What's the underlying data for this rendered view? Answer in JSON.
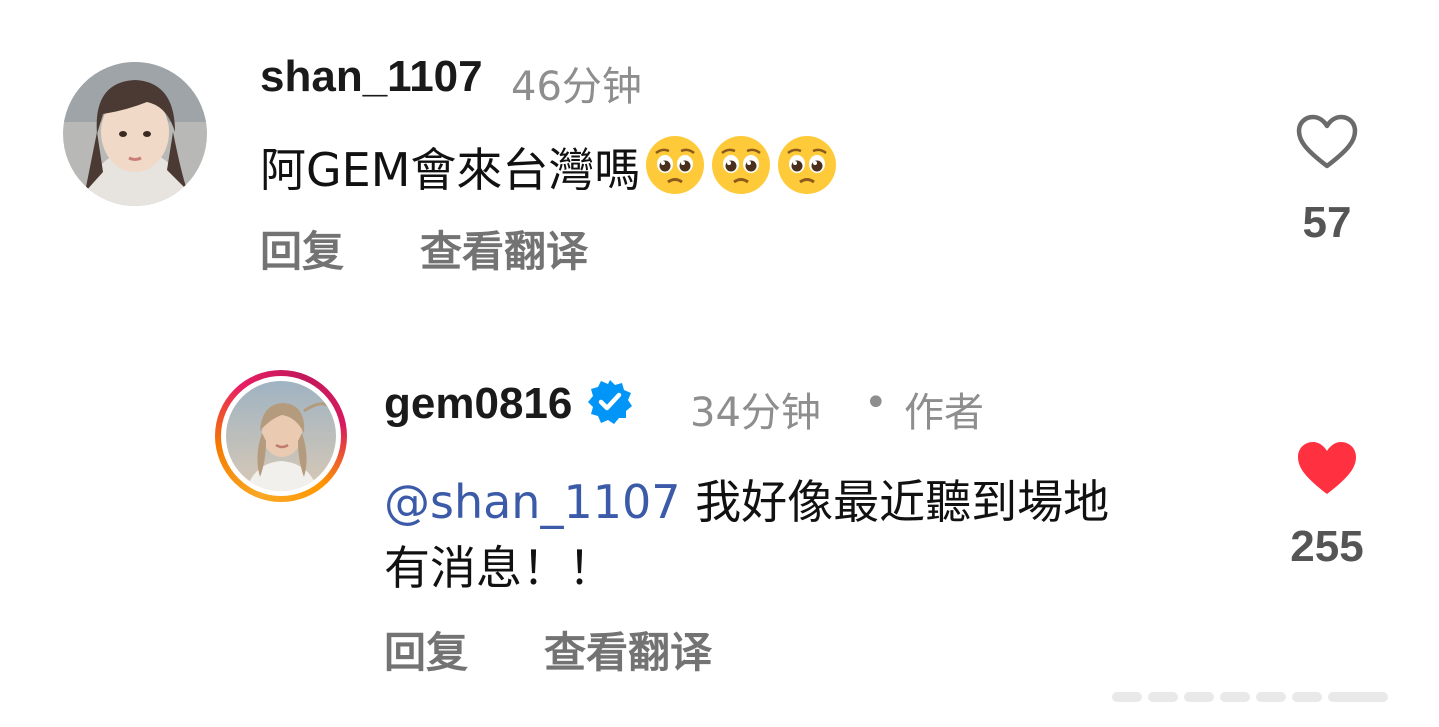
{
  "comments": [
    {
      "username": "shan_1107",
      "time": "46分钟",
      "text": "阿GEM會來台灣嗎",
      "emoji": [
        "pleading-face-emoji",
        "pleading-face-emoji",
        "pleading-face-emoji"
      ],
      "reply_label": "回复",
      "translate_label": "查看翻译",
      "like_count": "57",
      "liked": false
    },
    {
      "username": "gem0816",
      "verified": true,
      "time": "34分钟",
      "author_label": "作者",
      "mention": "@shan_1107",
      "text_line1": " 我好像最近聽到場地",
      "text_line2": "有消息！！",
      "reply_label": "回复",
      "translate_label": "查看翻译",
      "like_count": "255",
      "liked": true
    }
  ],
  "colors": {
    "like_red": "#ff3040",
    "verified_blue": "#0095f6",
    "mention_blue": "#3b5aa8",
    "meta_gray": "#8e8e8e"
  }
}
